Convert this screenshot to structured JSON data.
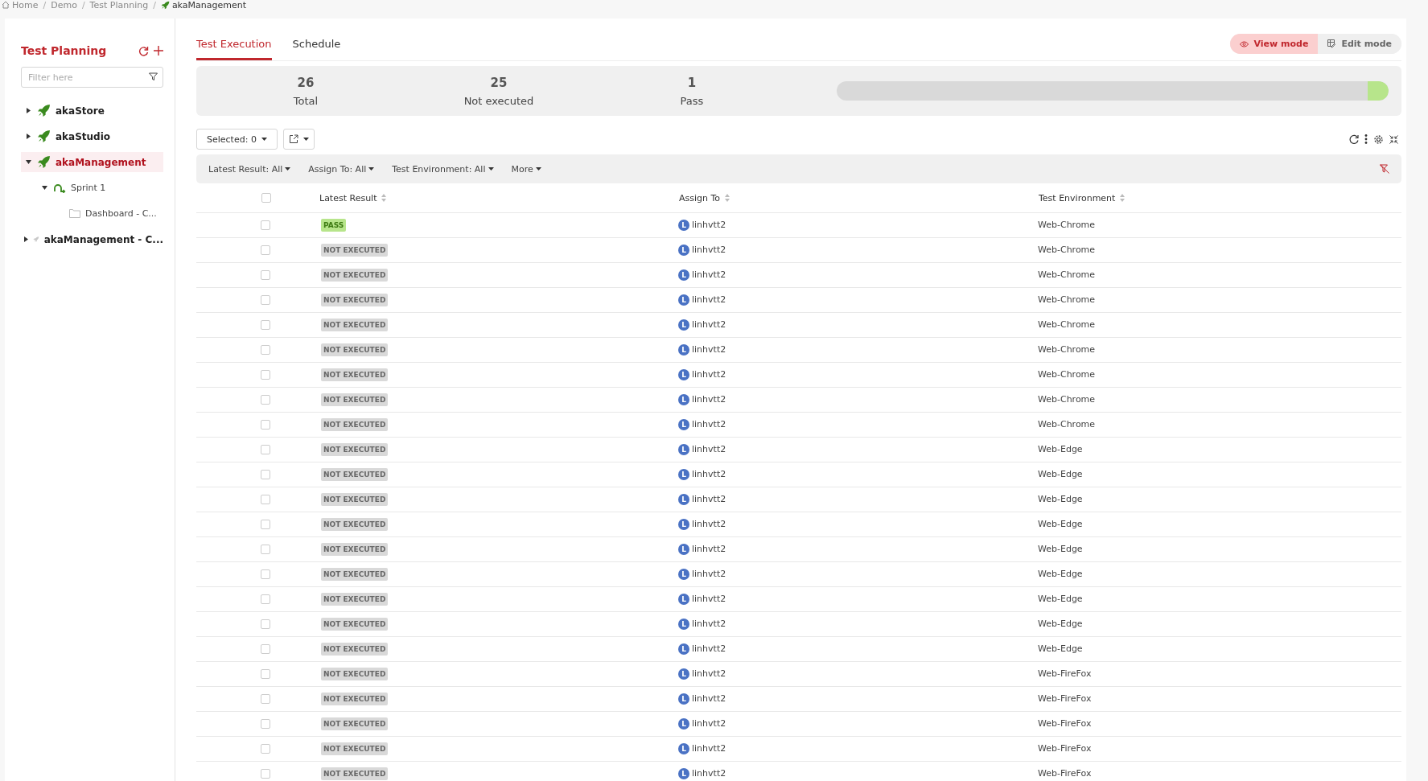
{
  "breadcrumb": [
    {
      "label": "Home",
      "kind": "home",
      "separator": "/"
    },
    {
      "label": "Demo",
      "kind": "plain",
      "separator": "/"
    },
    {
      "label": "Test Planning",
      "kind": "plain",
      "separator": "/"
    },
    {
      "label": "akaManagement",
      "kind": "project"
    }
  ],
  "sidebar": {
    "title": "Test Planning",
    "filter": {
      "placeholder": "Filter here"
    },
    "tree": [
      {
        "label": "akaStore",
        "kind": "project",
        "expanded": false,
        "selected": false,
        "inactive": false
      },
      {
        "label": "akaStudio",
        "kind": "project",
        "expanded": false,
        "selected": false,
        "inactive": false
      },
      {
        "label": "akaManagement",
        "kind": "project",
        "expanded": true,
        "selected": true,
        "inactive": false,
        "children": [
          {
            "label": "Sprint 1",
            "kind": "sprint",
            "expanded": true,
            "selected": false,
            "inactive": false,
            "children": [
              {
                "label": "Dashboard - C...",
                "kind": "folder",
                "selected": false,
                "inactive": false
              }
            ]
          }
        ]
      },
      {
        "label": "akaManagement - C...",
        "kind": "project",
        "expanded": false,
        "selected": false,
        "inactive": true
      }
    ]
  },
  "tabs": [
    {
      "label": "Test Execution",
      "selected": true
    },
    {
      "label": "Schedule",
      "selected": false
    }
  ],
  "modes": [
    {
      "label": "View mode",
      "kind": "view",
      "selected": true
    },
    {
      "label": "Edit mode",
      "kind": "edit",
      "selected": false
    }
  ],
  "summary": {
    "stats": [
      {
        "value": "26",
        "label": "Total"
      },
      {
        "value": "25",
        "label": "Not executed"
      },
      {
        "value": "1",
        "label": "Pass"
      }
    ],
    "level": 0.038
  },
  "toolbar": {
    "selected": "Selected: 0"
  },
  "filters": [
    "Latest Result: All",
    "Assign To: All",
    "Test Environment: All",
    "More"
  ],
  "table": {
    "all_checked": false,
    "columns": [
      "Latest Result",
      "Assign To",
      "Test Environment"
    ],
    "rows": [
      {
        "checked": false,
        "result": "PASS",
        "kind": "pass",
        "avatar": "L",
        "assignee": "linhvtt2",
        "environment": "Web-Chrome"
      },
      {
        "checked": false,
        "result": "NOT EXECUTED",
        "kind": "not-executed",
        "avatar": "L",
        "assignee": "linhvtt2",
        "environment": "Web-Chrome"
      },
      {
        "checked": false,
        "result": "NOT EXECUTED",
        "kind": "not-executed",
        "avatar": "L",
        "assignee": "linhvtt2",
        "environment": "Web-Chrome"
      },
      {
        "checked": false,
        "result": "NOT EXECUTED",
        "kind": "not-executed",
        "avatar": "L",
        "assignee": "linhvtt2",
        "environment": "Web-Chrome"
      },
      {
        "checked": false,
        "result": "NOT EXECUTED",
        "kind": "not-executed",
        "avatar": "L",
        "assignee": "linhvtt2",
        "environment": "Web-Chrome"
      },
      {
        "checked": false,
        "result": "NOT EXECUTED",
        "kind": "not-executed",
        "avatar": "L",
        "assignee": "linhvtt2",
        "environment": "Web-Chrome"
      },
      {
        "checked": false,
        "result": "NOT EXECUTED",
        "kind": "not-executed",
        "avatar": "L",
        "assignee": "linhvtt2",
        "environment": "Web-Chrome"
      },
      {
        "checked": false,
        "result": "NOT EXECUTED",
        "kind": "not-executed",
        "avatar": "L",
        "assignee": "linhvtt2",
        "environment": "Web-Chrome"
      },
      {
        "checked": false,
        "result": "NOT EXECUTED",
        "kind": "not-executed",
        "avatar": "L",
        "assignee": "linhvtt2",
        "environment": "Web-Chrome"
      },
      {
        "checked": false,
        "result": "NOT EXECUTED",
        "kind": "not-executed",
        "avatar": "L",
        "assignee": "linhvtt2",
        "environment": "Web-Edge"
      },
      {
        "checked": false,
        "result": "NOT EXECUTED",
        "kind": "not-executed",
        "avatar": "L",
        "assignee": "linhvtt2",
        "environment": "Web-Edge"
      },
      {
        "checked": false,
        "result": "NOT EXECUTED",
        "kind": "not-executed",
        "avatar": "L",
        "assignee": "linhvtt2",
        "environment": "Web-Edge"
      },
      {
        "checked": false,
        "result": "NOT EXECUTED",
        "kind": "not-executed",
        "avatar": "L",
        "assignee": "linhvtt2",
        "environment": "Web-Edge"
      },
      {
        "checked": false,
        "result": "NOT EXECUTED",
        "kind": "not-executed",
        "avatar": "L",
        "assignee": "linhvtt2",
        "environment": "Web-Edge"
      },
      {
        "checked": false,
        "result": "NOT EXECUTED",
        "kind": "not-executed",
        "avatar": "L",
        "assignee": "linhvtt2",
        "environment": "Web-Edge"
      },
      {
        "checked": false,
        "result": "NOT EXECUTED",
        "kind": "not-executed",
        "avatar": "L",
        "assignee": "linhvtt2",
        "environment": "Web-Edge"
      },
      {
        "checked": false,
        "result": "NOT EXECUTED",
        "kind": "not-executed",
        "avatar": "L",
        "assignee": "linhvtt2",
        "environment": "Web-Edge"
      },
      {
        "checked": false,
        "result": "NOT EXECUTED",
        "kind": "not-executed",
        "avatar": "L",
        "assignee": "linhvtt2",
        "environment": "Web-Edge"
      },
      {
        "checked": false,
        "result": "NOT EXECUTED",
        "kind": "not-executed",
        "avatar": "L",
        "assignee": "linhvtt2",
        "environment": "Web-FireFox"
      },
      {
        "checked": false,
        "result": "NOT EXECUTED",
        "kind": "not-executed",
        "avatar": "L",
        "assignee": "linhvtt2",
        "environment": "Web-FireFox"
      },
      {
        "checked": false,
        "result": "NOT EXECUTED",
        "kind": "not-executed",
        "avatar": "L",
        "assignee": "linhvtt2",
        "environment": "Web-FireFox"
      },
      {
        "checked": false,
        "result": "NOT EXECUTED",
        "kind": "not-executed",
        "avatar": "L",
        "assignee": "linhvtt2",
        "environment": "Web-FireFox"
      },
      {
        "checked": false,
        "result": "NOT EXECUTED",
        "kind": "not-executed",
        "avatar": "L",
        "assignee": "linhvtt2",
        "environment": "Web-FireFox"
      }
    ]
  }
}
